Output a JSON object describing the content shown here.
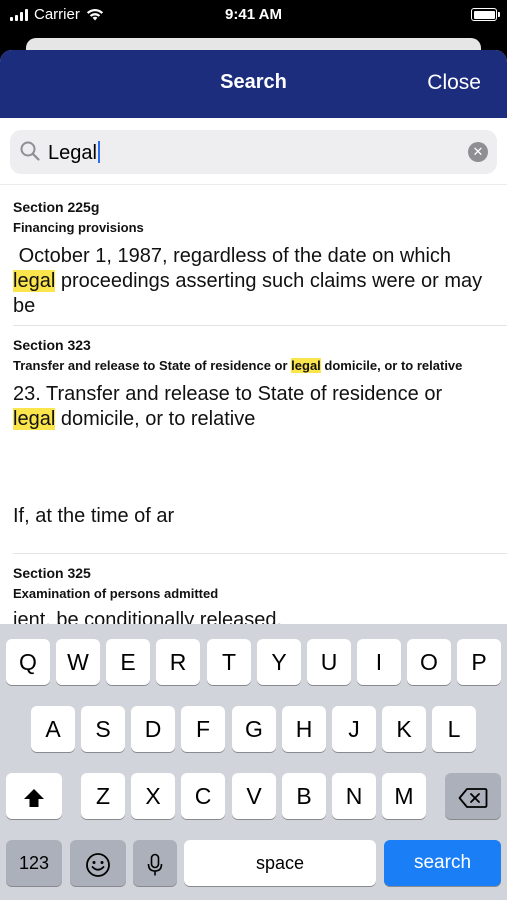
{
  "status_bar": {
    "carrier": "Carrier",
    "time": "9:41 AM"
  },
  "nav": {
    "title": "Search",
    "close_label": "Close"
  },
  "search": {
    "value": "Legal"
  },
  "results": [
    {
      "section": "Section 225g",
      "title": "Financing provisions",
      "body_before": " October 1, 1987, regardless of the date on which ",
      "body_highlight": "legal",
      "body_after": " proceedings asserting such claims were or may be"
    },
    {
      "section": "Section 323",
      "title_before": "Transfer and release to State of residence or ",
      "title_highlight": "legal",
      "title_after": " domicile, or to relative",
      "body_before": "23. Transfer and release to State of residence or ",
      "body_highlight": "legal",
      "body_after": " domicile, or to relative",
      "body_extra": "If, at the time of ar"
    },
    {
      "section": "Section 325",
      "title": "Examination of persons admitted",
      "body": "ient, be conditionally released."
    }
  ],
  "keyboard": {
    "row1": [
      "Q",
      "W",
      "E",
      "R",
      "T",
      "Y",
      "U",
      "I",
      "O",
      "P"
    ],
    "row2": [
      "A",
      "S",
      "D",
      "F",
      "G",
      "H",
      "J",
      "K",
      "L"
    ],
    "row3": [
      "Z",
      "X",
      "C",
      "V",
      "B",
      "N",
      "M"
    ],
    "numbers_label": "123",
    "space_label": "space",
    "search_label": "search"
  },
  "icons": {
    "search": "magnifier-icon",
    "clear": "clear-icon",
    "shift": "shift-icon",
    "backspace": "backspace-icon",
    "emoji": "emoji-icon",
    "mic": "microphone-icon"
  },
  "colors": {
    "nav_bg": "#1c2d7d",
    "highlight": "#fbe54d",
    "search_key": "#1a7ef7"
  }
}
